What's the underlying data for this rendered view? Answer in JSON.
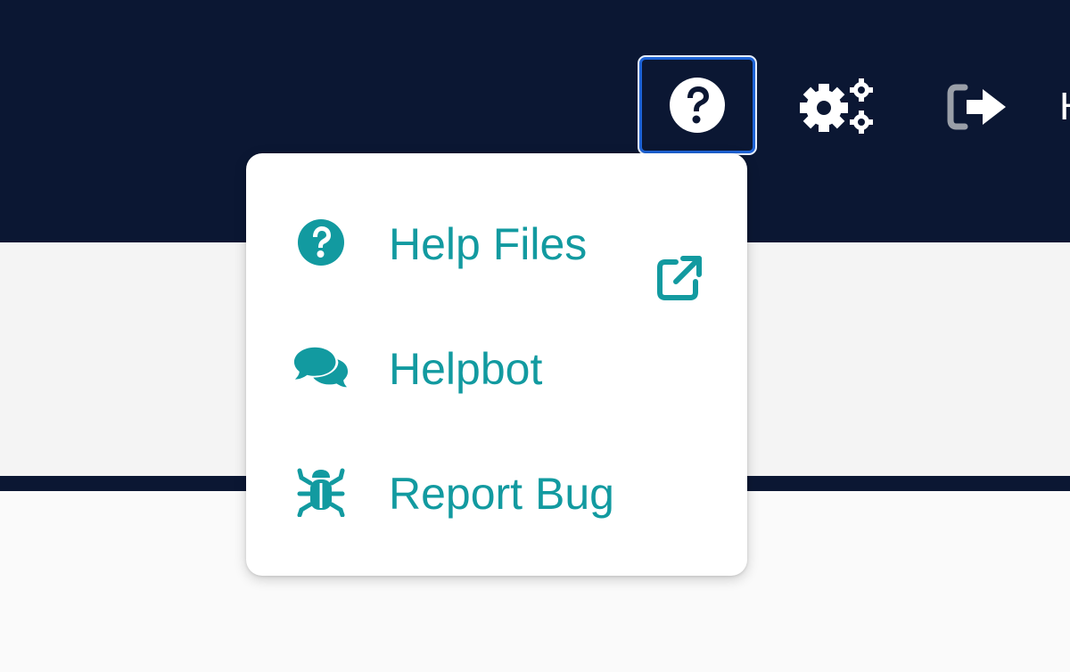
{
  "topbar": {
    "help_button": {
      "icon": "question-circle-icon",
      "focused": true
    },
    "settings_button": {
      "icon": "gears-icon"
    },
    "logout_button": {
      "icon": "logout-icon"
    },
    "partial_label": "H"
  },
  "help_menu": {
    "items": [
      {
        "label": "Help Files",
        "icon": "question-circle-icon",
        "external_icon": "external-link-icon"
      },
      {
        "label": "Helpbot",
        "icon": "comments-icon"
      },
      {
        "label": "Report Bug",
        "icon": "bug-icon"
      }
    ]
  },
  "colors": {
    "topbar_bg": "#0b1733",
    "accent_teal": "#129aa0",
    "focus_ring": "#1e63d6",
    "menu_bg": "#ffffff"
  }
}
